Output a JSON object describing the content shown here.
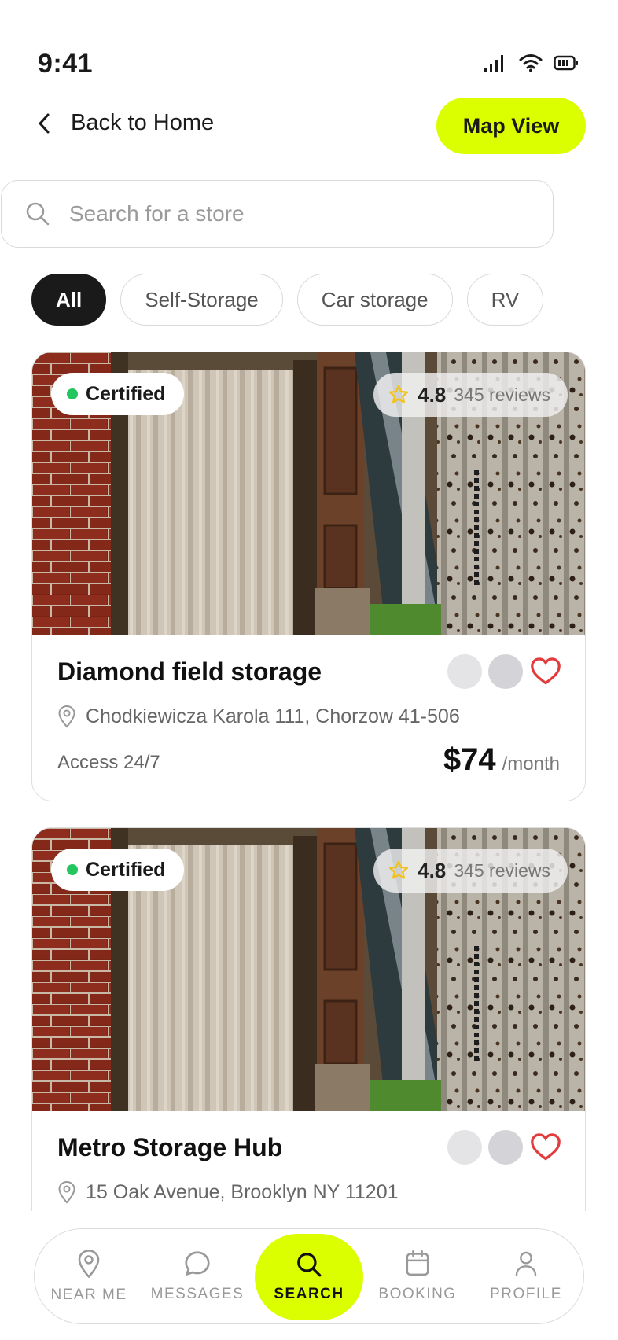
{
  "status_bar": {
    "time": "9:41"
  },
  "header": {
    "back_label": "Back to Home",
    "map_button": "Map View"
  },
  "search": {
    "placeholder": "Search for a store",
    "value": ""
  },
  "filters": [
    {
      "label": "All",
      "active": true
    },
    {
      "label": "Self-Storage",
      "active": false
    },
    {
      "label": "Car storage",
      "active": false
    },
    {
      "label": "RV",
      "active": false
    }
  ],
  "listings": [
    {
      "badge": "Certified",
      "rating": "4.8",
      "reviews": "345 reviews",
      "title": "Diamond field storage",
      "address": "Chodkiewicza Karola 111, Chorzow 41-506",
      "access": "Access 24/7",
      "price": "$74",
      "period": "/month",
      "favorite": false
    },
    {
      "badge": "Certified",
      "rating": "4.8",
      "reviews": "345 reviews",
      "title": "Metro Storage Hub",
      "address": "15 Oak Avenue, Brooklyn NY 11201",
      "favorite": false
    }
  ],
  "bottom_nav": [
    {
      "label": "NEAR ME",
      "icon": "map-pin-icon",
      "active": false
    },
    {
      "label": "MESSAGES",
      "icon": "chat-bubble-icon",
      "active": false
    },
    {
      "label": "SEARCH",
      "icon": "search-icon",
      "active": true
    },
    {
      "label": "BOOKING",
      "icon": "calendar-icon",
      "active": false
    },
    {
      "label": "PROFILE",
      "icon": "user-icon",
      "active": false
    }
  ],
  "colors": {
    "accent": "#dcff00",
    "active_chip": "#1a1a1a",
    "certified_dot": "#22c55e",
    "heart": "#e23c3c",
    "star": "#f2c21a"
  }
}
